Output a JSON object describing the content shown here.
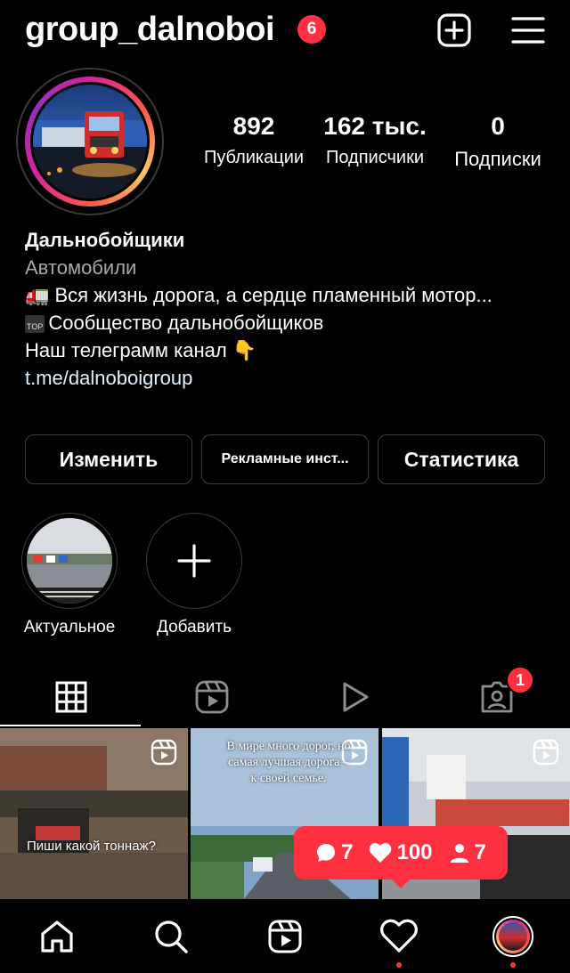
{
  "header": {
    "username": "group_dalnoboi",
    "notification_count": "6",
    "icons": [
      "create-plus-icon",
      "menu-hamburger-icon"
    ]
  },
  "profile": {
    "stats": [
      {
        "value": "892",
        "label": "Публикации"
      },
      {
        "value": "162 тыс.",
        "label": "Подписчики"
      },
      {
        "value": "0",
        "label": "Подписки"
      }
    ],
    "name": "Дальнобойщики",
    "category": "Автомобили",
    "bio_line1": "🚛 Вся жизнь дорога, а сердце пламенный мотор...",
    "bio_line2_badge": "TOP",
    "bio_line2": "Сообщество дальнобойщиков",
    "bio_line3": "Наш телеграмм канал 👇",
    "link": "t.me/dalnoboigroup"
  },
  "buttons": {
    "edit": "Изменить",
    "ads": "Рекламные инст...",
    "stats": "Статистика"
  },
  "highlights": [
    {
      "label": "Актуальное"
    },
    {
      "label": "Добавить"
    }
  ],
  "tabs": {
    "icons": [
      "grid-icon",
      "reels-icon",
      "video-play-icon",
      "tagged-icon"
    ],
    "tagged_badge": "1"
  },
  "posts": [
    {
      "caption": "Пиши какой тоннаж?"
    },
    {
      "caption": "В мире много дорог, но самая лучшая дорога – к своей семье."
    },
    {
      "caption": ""
    }
  ],
  "activity_toast": {
    "comments": "7",
    "likes": "100",
    "followers": "7"
  },
  "bottom_nav": {
    "icons": [
      "home-icon",
      "search-icon",
      "reels-icon",
      "activity-heart-icon",
      "profile-avatar-icon"
    ]
  },
  "colors": {
    "accent_red": "#ff3040",
    "background": "#000000",
    "secondary_text": "#a8a8a8",
    "border": "#3d3d3d"
  }
}
